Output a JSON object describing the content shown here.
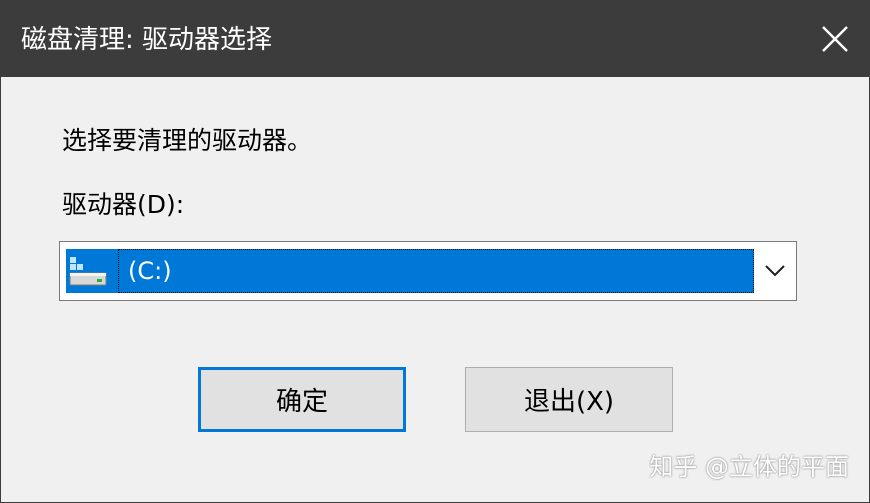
{
  "window": {
    "title": "磁盘清理: 驱动器选择",
    "close_icon": "close-icon"
  },
  "dialog": {
    "instruction": "选择要清理的驱动器。",
    "drive_label": "驱动器(D):",
    "drive_select": {
      "selected_value": "(C:)",
      "icon": "drive-icon",
      "arrow_icon": "chevron-down-icon"
    },
    "ok_label": "确定",
    "cancel_label": "退出(X)"
  },
  "watermark": "知乎 @立体的平面",
  "colors": {
    "titlebar": "#3c3c3c",
    "background": "#f0f0f0",
    "selection": "#0078d7",
    "button_face": "#e1e1e1",
    "focus_border": "#0078d7"
  }
}
